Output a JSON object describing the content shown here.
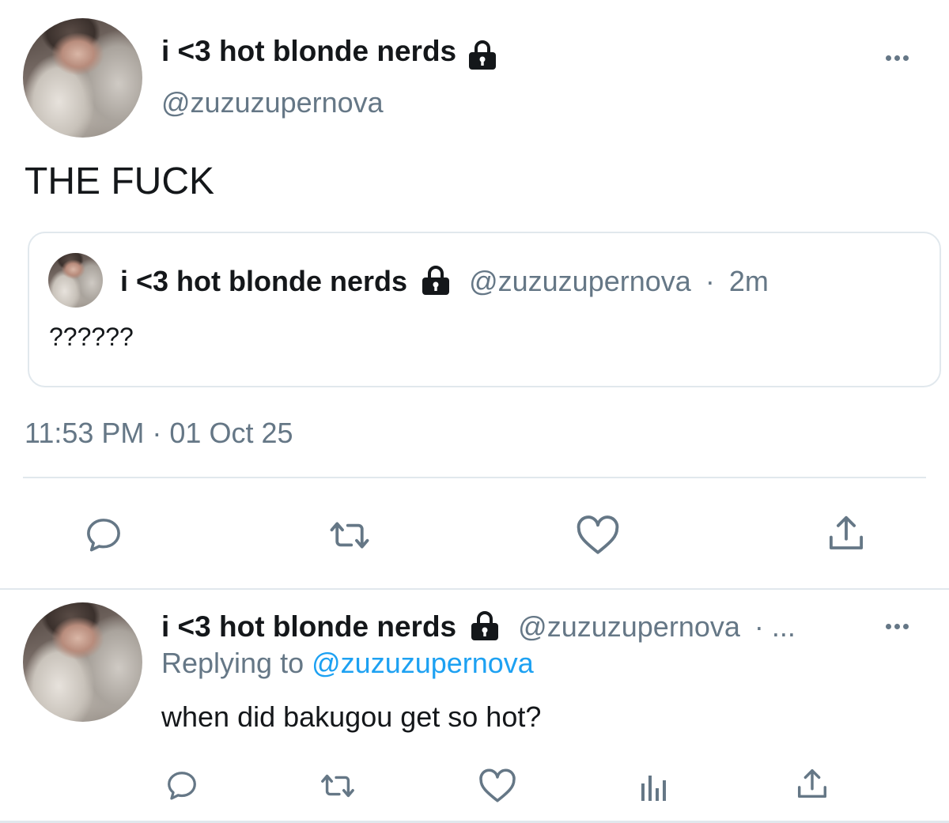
{
  "main_tweet": {
    "display_name": "i <3 hot blonde nerds",
    "handle": "@zuzuzupernova",
    "text": "THE FUCK",
    "timestamp": "11:53 PM · 01 Oct 25"
  },
  "quoted_tweet": {
    "display_name": "i <3 hot blonde nerds",
    "handle": "@zuzuzupernova",
    "separator": "·",
    "time": "2m",
    "text": "??????"
  },
  "reply_tweet": {
    "display_name": "i <3 hot blonde nerds",
    "handle": "@zuzuzupernova",
    "separator": "· ...",
    "replying_prefix": "Replying to",
    "replying_handle": "@zuzuzupernova",
    "text": "when did bakugou get so hot?"
  },
  "colors": {
    "text": "#14171a",
    "muted": "#657786",
    "link": "#1da1f2",
    "border": "#e1e8ed"
  },
  "icons": [
    "reply-icon",
    "retweet-icon",
    "like-icon",
    "share-icon",
    "analytics-icon",
    "lock-icon",
    "more-icon"
  ]
}
